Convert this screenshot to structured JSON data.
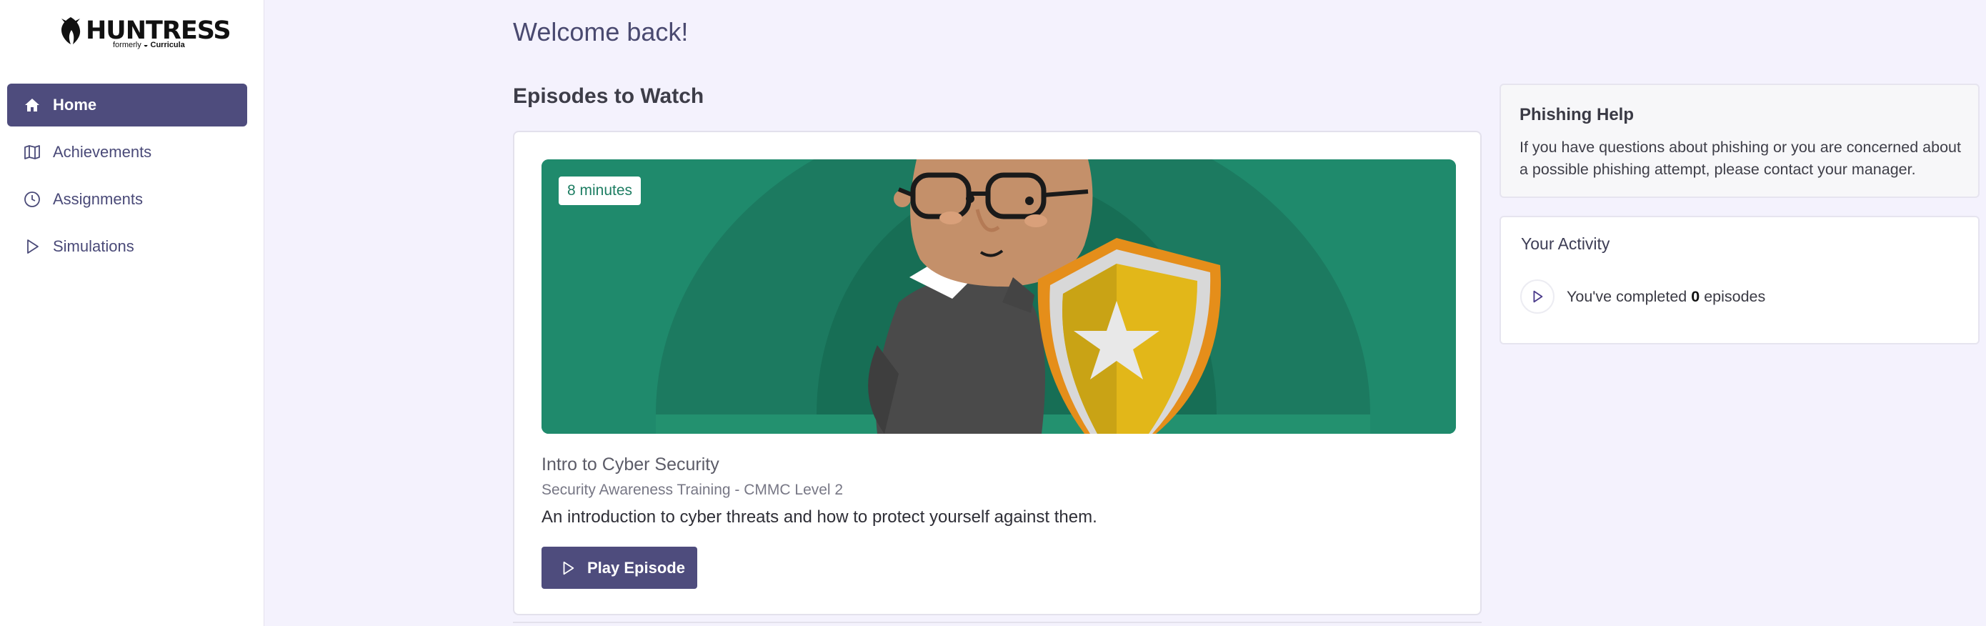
{
  "brand": {
    "name": "HUNTRESS",
    "sub_prefix": "formerly",
    "sub_name": "Curricula"
  },
  "sidebar": {
    "items": [
      {
        "label": "Home",
        "icon": "home-icon",
        "active": true
      },
      {
        "label": "Achievements",
        "icon": "map-icon",
        "active": false
      },
      {
        "label": "Assignments",
        "icon": "clock-icon",
        "active": false
      },
      {
        "label": "Simulations",
        "icon": "play-icon",
        "active": false
      }
    ]
  },
  "main": {
    "welcome": "Welcome back!",
    "episodes_heading": "Episodes to Watch",
    "episode": {
      "duration": "8 minutes",
      "title": "Intro to Cyber Security",
      "series": "Security Awareness Training - CMMC Level 2",
      "description": "An introduction to cyber threats and how to protect yourself against them.",
      "play_label": "Play Episode"
    }
  },
  "phishing": {
    "title": "Phishing Help",
    "text": "If you have questions about phishing or you are concerned about a possible phishing attempt, please contact your manager."
  },
  "activity": {
    "title": "Your Activity",
    "prefix": "You've completed",
    "count": "0",
    "suffix": "episodes"
  },
  "colors": {
    "accent": "#4e4c7d",
    "background": "#f4f2fd",
    "thumbnail": "#1f8a6c"
  }
}
